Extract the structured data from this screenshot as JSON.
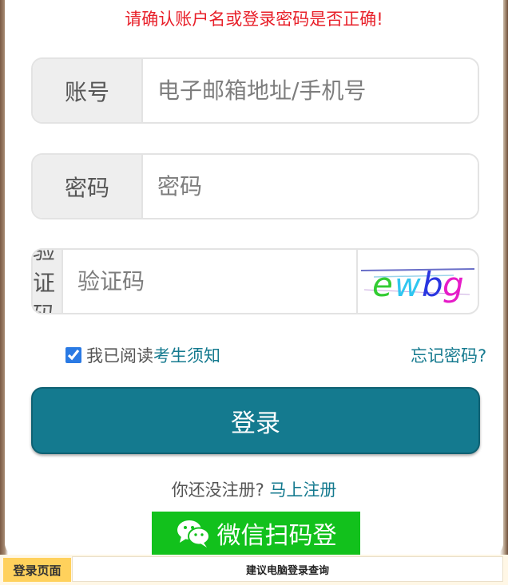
{
  "error_message": "请确认账户名或登录密码是否正确!",
  "account": {
    "label": "账号",
    "placeholder": "电子邮箱地址/手机号"
  },
  "password": {
    "label": "密码",
    "placeholder": "密码"
  },
  "captcha": {
    "label": "验证码",
    "placeholder": "验证码",
    "image_text": "ewbg"
  },
  "remember": {
    "prefix": "我已阅读",
    "link": "考生须知",
    "checked": true
  },
  "forgot_link": "忘记密码?",
  "login_button": "登录",
  "register": {
    "prompt": "你还没注册?",
    "link": "马上注册"
  },
  "wechat_button": "微信扫码登",
  "bottom_bar": {
    "tag": "登录页面",
    "notice": "建议电脑登录查询"
  },
  "colors": {
    "error": "#e8202a",
    "primary": "#147a8f",
    "wechat": "#12c11c",
    "link": "#157a8f"
  }
}
